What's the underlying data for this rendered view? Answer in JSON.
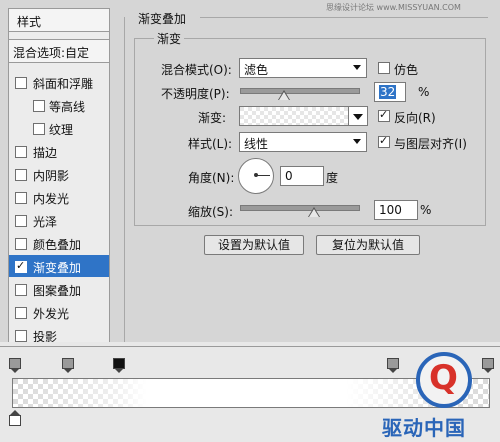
{
  "watermark": "思缘设计论坛 www.MISSYUAN.COM",
  "left_panel": {
    "header": "样式",
    "blend_options": "混合选项:自定",
    "items": [
      {
        "label": "斜面和浮雕",
        "checked": false,
        "sub": false
      },
      {
        "label": "等高线",
        "checked": false,
        "sub": true
      },
      {
        "label": "纹理",
        "checked": false,
        "sub": true
      },
      {
        "label": "描边",
        "checked": false,
        "sub": false
      },
      {
        "label": "内阴影",
        "checked": false,
        "sub": false
      },
      {
        "label": "内发光",
        "checked": false,
        "sub": false
      },
      {
        "label": "光泽",
        "checked": false,
        "sub": false
      },
      {
        "label": "颜色叠加",
        "checked": false,
        "sub": false
      },
      {
        "label": "渐变叠加",
        "checked": true,
        "sub": false
      },
      {
        "label": "图案叠加",
        "checked": false,
        "sub": false
      },
      {
        "label": "外发光",
        "checked": false,
        "sub": false
      },
      {
        "label": "投影",
        "checked": false,
        "sub": false
      }
    ]
  },
  "panel": {
    "title": "渐变叠加",
    "group_title": "渐变",
    "blend_mode_label": "混合模式(O):",
    "blend_mode_value": "滤色",
    "dither_label": "仿色",
    "opacity_label": "不透明度(P):",
    "opacity_value": "32",
    "opacity_unit": "%",
    "gradient_label": "渐变:",
    "reverse_label": "反向(R)",
    "style_label": "样式(L):",
    "style_value": "线性",
    "align_label": "与图层对齐(I)",
    "angle_label": "角度(N):",
    "angle_value": "0",
    "angle_unit": "度",
    "scale_label": "缩放(S):",
    "scale_value": "100",
    "scale_unit": "%",
    "opacity_level_pct": 32,
    "scale_level_pct": 50,
    "set_default": "设置为默认值",
    "reset_default": "复位为默认值"
  },
  "checks": {
    "dither": false,
    "reverse": true,
    "align": true
  },
  "logo": {
    "letter": "Q",
    "text": "驱动中国"
  }
}
